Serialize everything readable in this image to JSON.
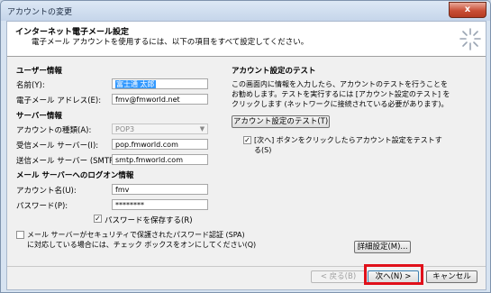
{
  "window": {
    "title": "アカウントの変更",
    "close_glyph": "x"
  },
  "header": {
    "title": "インターネット電子メール設定",
    "subtitle": "電子メール アカウントを使用するには、以下の項目をすべて設定してください。"
  },
  "user_info": {
    "section_label": "ユーザー情報",
    "name_label": "名前(Y):",
    "name_value": "富士通 太郎",
    "email_label": "電子メール アドレス(E):",
    "email_value": "fmv@fmworld.net"
  },
  "server_info": {
    "section_label": "サーバー情報",
    "account_type_label": "アカウントの種類(A):",
    "account_type_value": "POP3",
    "incoming_label": "受信メール サーバー(I):",
    "incoming_value": "pop.fmworld.com",
    "outgoing_label": "送信メール サーバー (SMTP)(O):",
    "outgoing_value": "smtp.fmworld.com"
  },
  "logon_info": {
    "section_label": "メール サーバーへのログオン情報",
    "account_name_label": "アカウント名(U):",
    "account_name_value": "fmv",
    "password_label": "パスワード(P):",
    "password_value": "********",
    "remember_password_label": "パスワードを保存する(R)",
    "spa_label_line1": "メール サーバーがセキュリティで保護されたパスワード認証 (SPA)",
    "spa_label_line2": "に対応している場合には、チェック ボックスをオンにしてください(Q)"
  },
  "test_settings": {
    "section_label": "アカウント設定のテスト",
    "description_line1": "この画面内に情報を入力したら、アカウントのテストを行うことを",
    "description_line2": "お勧めします。テストを実行するには [アカウント設定のテスト] を",
    "description_line3": "クリックします (ネットワークに接続されている必要があります)。",
    "test_button_label": "アカウント設定のテスト(T)",
    "auto_test_label_line1": "[次へ] ボタンをクリックしたらアカウント設定をテストす",
    "auto_test_label_line2": "る(S)"
  },
  "more_settings_label": "詳細設定(M)...",
  "footer": {
    "back_label": "< 戻る(B)",
    "next_label": "次へ(N) >",
    "cancel_label": "キャンセル"
  },
  "checkbox_glyph": "✓",
  "combo_arrow_glyph": "▼",
  "colors": {
    "highlight": "#e0101a",
    "selection": "#3399ff"
  }
}
